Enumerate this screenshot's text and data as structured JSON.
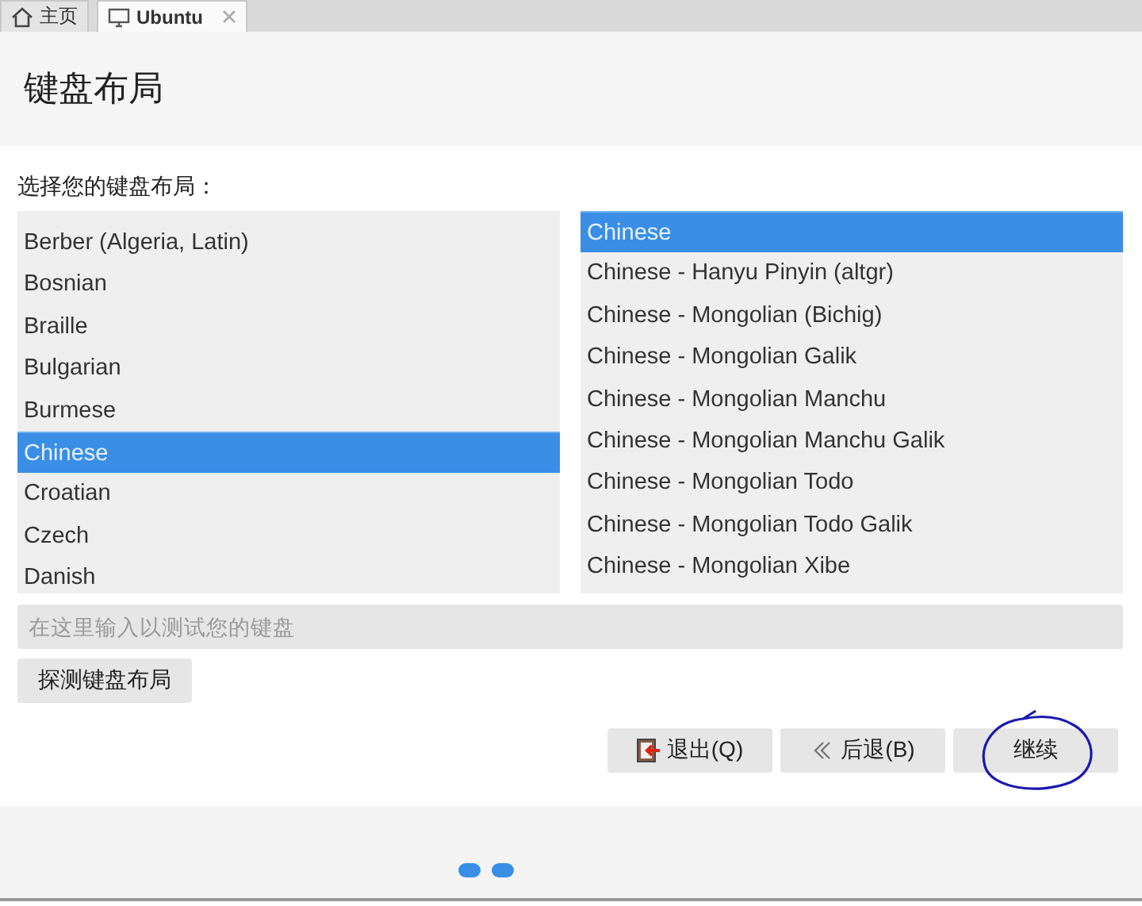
{
  "tabs": [
    {
      "label": "主页",
      "kind": "home",
      "selected": false,
      "closable": false
    },
    {
      "label": "Ubuntu",
      "kind": "machine",
      "selected": true,
      "closable": true
    }
  ],
  "title": "键盘布局",
  "prompt": "选择您的键盘布局：",
  "layouts": [
    {
      "label": "Berber (Algeria, Latin)",
      "selected": false
    },
    {
      "label": "Bosnian",
      "selected": false
    },
    {
      "label": "Braille",
      "selected": false
    },
    {
      "label": "Bulgarian",
      "selected": false
    },
    {
      "label": "Burmese",
      "selected": false
    },
    {
      "label": "Chinese",
      "selected": true
    },
    {
      "label": "Croatian",
      "selected": false
    },
    {
      "label": "Czech",
      "selected": false
    },
    {
      "label": "Danish",
      "selected": false
    }
  ],
  "variants": [
    {
      "label": "Chinese",
      "selected": true
    },
    {
      "label": "Chinese - Hanyu Pinyin (altgr)",
      "selected": false
    },
    {
      "label": "Chinese - Mongolian (Bichig)",
      "selected": false
    },
    {
      "label": "Chinese - Mongolian Galik",
      "selected": false
    },
    {
      "label": "Chinese - Mongolian Manchu",
      "selected": false
    },
    {
      "label": "Chinese - Mongolian Manchu Galik",
      "selected": false
    },
    {
      "label": "Chinese - Mongolian Todo",
      "selected": false
    },
    {
      "label": "Chinese - Mongolian Todo Galik",
      "selected": false
    },
    {
      "label": "Chinese - Mongolian Xibe",
      "selected": false
    }
  ],
  "test_field": {
    "placeholder": "在这里输入以测试您的键盘"
  },
  "detect_button": "探测键盘布局",
  "nav_buttons": [
    {
      "label": "退出(Q)",
      "kind": "quit",
      "circled": false
    },
    {
      "label": "后退(B)",
      "kind": "back",
      "circled": false
    },
    {
      "label": "继续",
      "kind": "continue",
      "circled": true
    }
  ]
}
